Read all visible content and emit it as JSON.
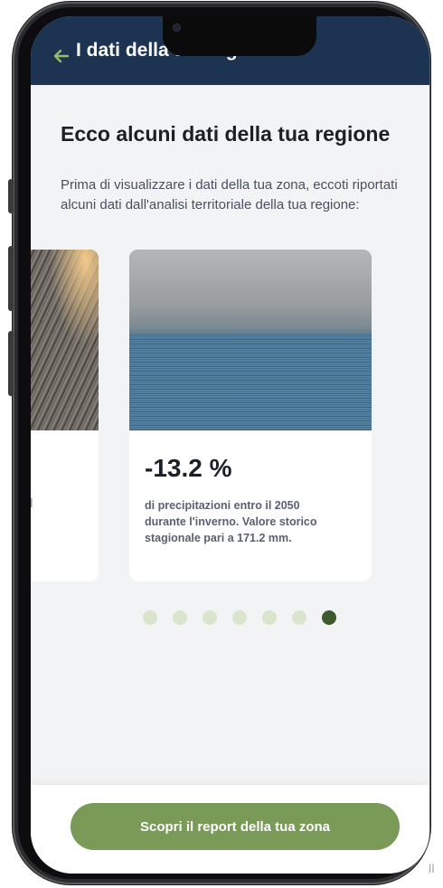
{
  "header": {
    "title": "I dati della tua regione",
    "back_icon": "arrow-left-icon"
  },
  "main": {
    "heading": "Ecco alcuni dati della tua regione",
    "intro": "Prima di visualizzare i dati della tua zona, eccoti riportati alcuni dati dall'analisi territoriale della tua regione:"
  },
  "cards": {
    "previous": {
      "partial_text": "l"
    },
    "current": {
      "value": "-13.2 %",
      "description": "di precipitazioni entro il 2050 durante l'inverno. Valore storico stagionale pari a 171.2 mm."
    }
  },
  "pagination": {
    "count": 7,
    "active_index": 6
  },
  "footer": {
    "cta_label": "Scopri il report della tua zona"
  },
  "stray_mark": "ll",
  "colors": {
    "header_bg": "#1d3352",
    "accent_green": "#7a9a58",
    "dot_active": "#3c5a2b",
    "dot_inactive": "#d9e5cb",
    "back_icon": "#8fbf6a"
  }
}
